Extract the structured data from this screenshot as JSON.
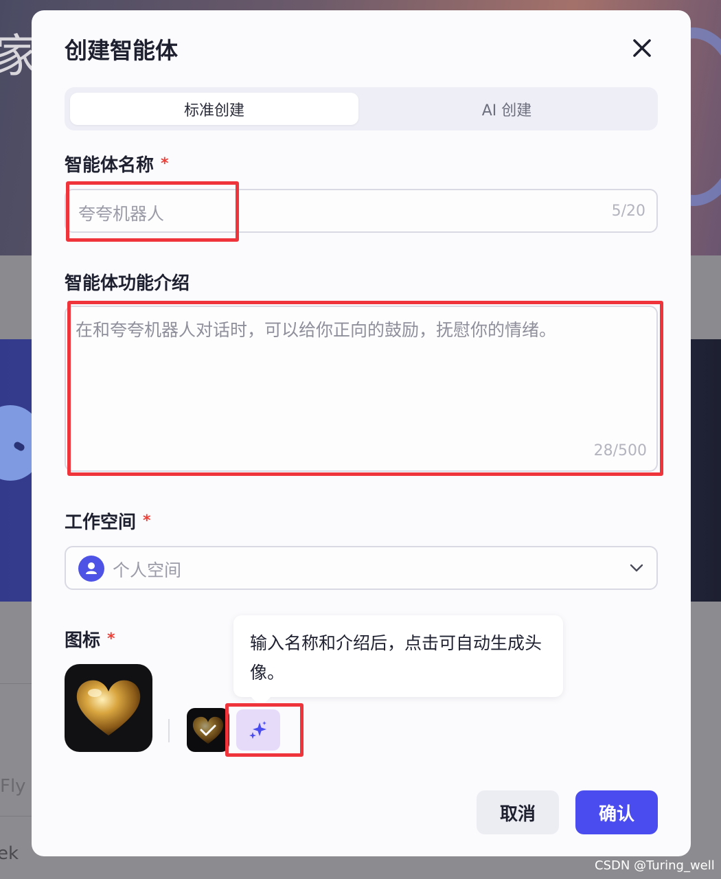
{
  "background": {
    "partial_text_top": "家",
    "partial_text_fly": "Fly",
    "partial_text_ek": "ek"
  },
  "modal": {
    "title": "创建智能体",
    "tabs": [
      {
        "label": "标准创建",
        "active": true
      },
      {
        "label": "AI 创建",
        "active": false
      }
    ],
    "name_field": {
      "label": "智能体名称",
      "required_mark": "*",
      "value": "夸夸机器人",
      "counter": "5/20"
    },
    "description_field": {
      "label": "智能体功能介绍",
      "value": "在和夸夸机器人对话时，可以给你正向的鼓励，抚慰你的情绪。",
      "counter": "28/500"
    },
    "workspace_field": {
      "label": "工作空间",
      "required_mark": "*",
      "selected": "个人空间"
    },
    "icon_field": {
      "label": "图标",
      "required_mark": "*",
      "selected_icon": "gold-heart",
      "tooltip": "输入名称和介绍后，点击可自动生成头像。"
    },
    "buttons": {
      "cancel": "取消",
      "confirm": "确认"
    }
  },
  "colors": {
    "primary": "#4b4cf0",
    "required": "#ef3e36",
    "highlight": "#f0343c",
    "ai_button_bg": "#e6dcfa"
  },
  "watermark": "CSDN @Turing_well"
}
